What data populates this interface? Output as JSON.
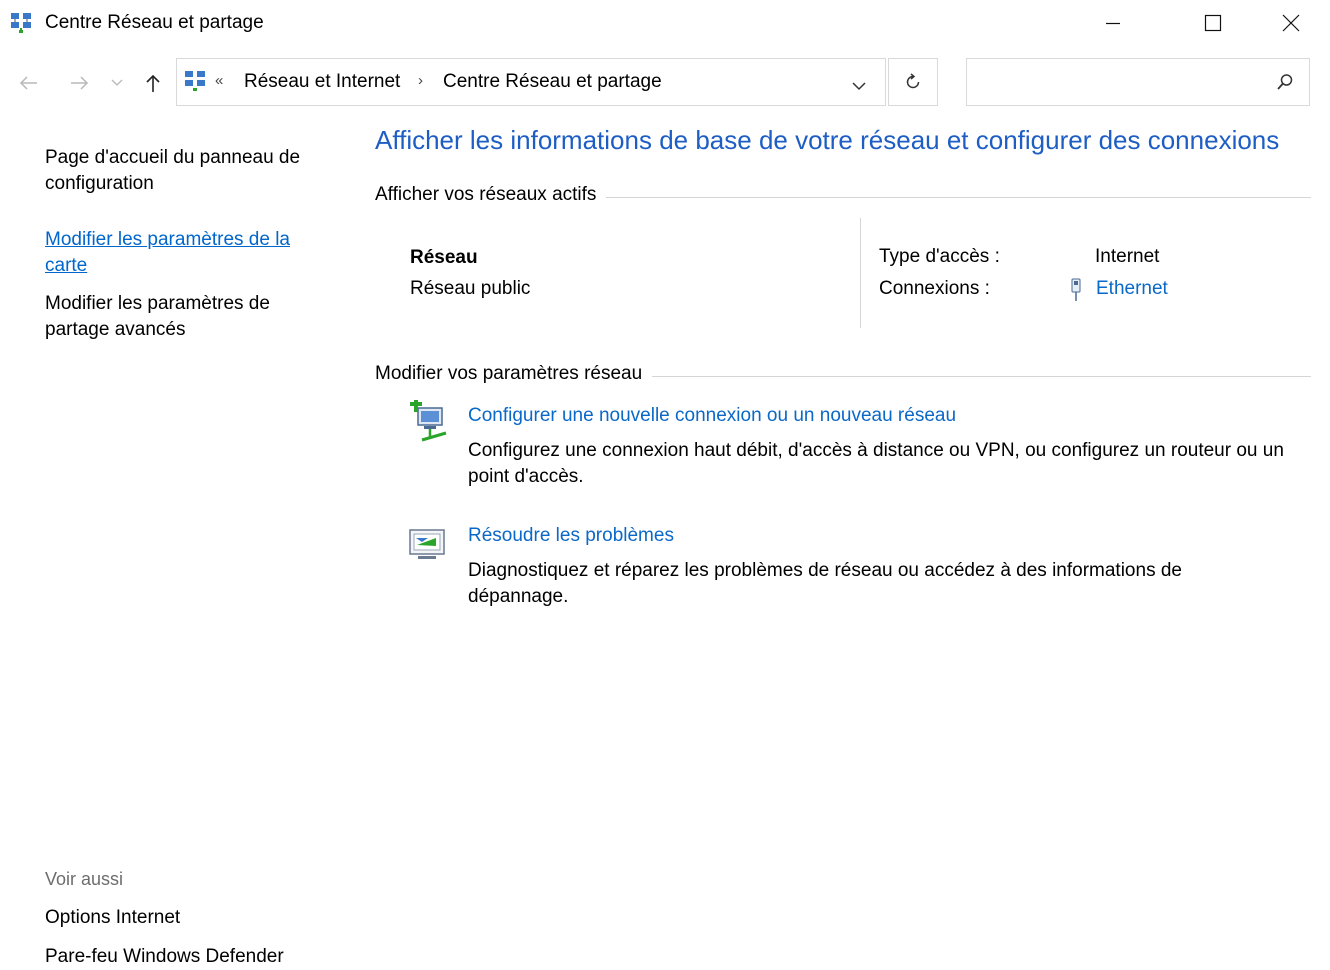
{
  "window": {
    "title": "Centre Réseau et partage",
    "icon": "network-center-icon",
    "controls": [
      "minimize",
      "maximize",
      "close"
    ]
  },
  "address": {
    "overflow_glyph": "«",
    "crumbs": [
      "Réseau et Internet",
      "Centre Réseau et partage"
    ],
    "separator": "›",
    "search_placeholder": ""
  },
  "sidebar": {
    "home_link": "Page d'accueil du panneau de configuration",
    "items": [
      {
        "label": "Modifier les paramètres de la carte",
        "active": true
      },
      {
        "label": "Modifier les paramètres de partage avancés",
        "active": false
      }
    ],
    "see_also": {
      "heading": "Voir aussi",
      "links": [
        "Options Internet",
        "Pare-feu Windows Defender"
      ]
    }
  },
  "main": {
    "title": "Afficher les informations de base de votre réseau et configurer des connexions",
    "active_networks": {
      "heading": "Afficher vos réseaux actifs",
      "network_name": "Réseau",
      "network_type": "Réseau public",
      "access_type_label": "Type d'accès :",
      "access_type_value": "Internet",
      "connections_label": "Connexions :",
      "connections_value": "Ethernet"
    },
    "change_settings": {
      "heading": "Modifier vos paramètres réseau",
      "tasks": [
        {
          "title": "Configurer une nouvelle connexion ou un nouveau réseau",
          "description": "Configurez une connexion haut débit, d'accès à distance ou VPN, ou configurez un routeur ou un point d'accès.",
          "icon": "new-connection-icon"
        },
        {
          "title": "Résoudre les problèmes",
          "description": "Diagnostiquez et réparez les problèmes de réseau ou accédez à des informations de dépannage.",
          "icon": "troubleshoot-icon"
        }
      ]
    }
  },
  "colors": {
    "title_blue": "#1e5ec4",
    "link_blue": "#0a68c8",
    "muted_gray": "#6d6d6d"
  }
}
